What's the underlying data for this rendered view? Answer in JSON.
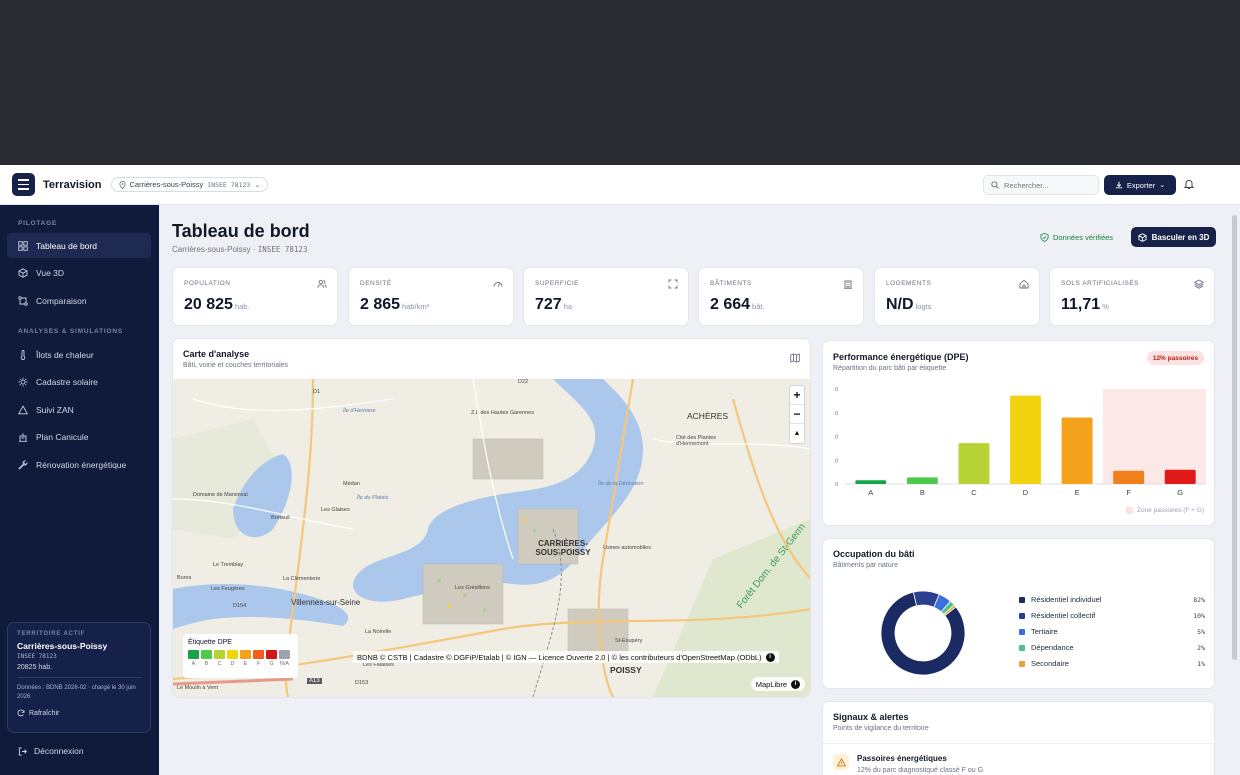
{
  "app": {
    "brand": "Terravision"
  },
  "topbar": {
    "location": "Carrières-sous-Poissy",
    "insee": "INSEE 78123",
    "search_placeholder": "Rechercher...",
    "export_label": "Exporter"
  },
  "sidebar": {
    "section1": "PILOTAGE",
    "section2": "ANALYSES & SIMULATIONS",
    "items": [
      {
        "label": "Tableau de bord",
        "icon": "grid-icon"
      },
      {
        "label": "Vue 3D",
        "icon": "cube-icon"
      },
      {
        "label": "Comparaison",
        "icon": "compare-icon"
      },
      {
        "label": "Îlots de chaleur",
        "icon": "thermometer-icon"
      },
      {
        "label": "Cadastre solaire",
        "icon": "sun-icon"
      },
      {
        "label": "Suivi ZAN",
        "icon": "triangle-icon"
      },
      {
        "label": "Plan Canicule",
        "icon": "building-icon"
      },
      {
        "label": "Rénovation énergétique",
        "icon": "wrench-icon"
      }
    ],
    "territory": {
      "label": "TERRITOIRE ACTIF",
      "name": "Carrières-sous-Poissy",
      "insee": "INSEE 78123",
      "population": "20825 hab.",
      "data_line": "Données : BDNB 2026-02 · chargé le 30 juin 2026",
      "refresh": "Rafraîchir"
    },
    "logout": "Déconnexion"
  },
  "header": {
    "title": "Tableau de bord",
    "subtitle_name": "Carrières-sous-Poissy · ",
    "subtitle_insee": "INSEE 78123",
    "verified": "Données vérifiées",
    "toggle_3d": "Basculer en 3D"
  },
  "kpis": [
    {
      "label": "POPULATION",
      "value": "20 825",
      "unit": "hab.",
      "icon": "users-icon"
    },
    {
      "label": "DENSITÉ",
      "value": "2 865",
      "unit": "hab/km²",
      "icon": "gauge-icon"
    },
    {
      "label": "SUPERFICIE",
      "value": "727",
      "unit": "ha",
      "icon": "expand-icon"
    },
    {
      "label": "BÂTIMENTS",
      "value": "2 664",
      "unit": "bât.",
      "icon": "building-icon"
    },
    {
      "label": "LOGEMENTS",
      "value": "N/D",
      "unit": "logts",
      "icon": "home-icon"
    },
    {
      "label": "SOLS ARTIFICIALISÉS",
      "value": "11,71",
      "unit": "%",
      "icon": "layers-icon"
    }
  ],
  "map": {
    "title": "Carte d'analyse",
    "subtitle": "Bâti, voirie et couches territoriales",
    "legend_title": "Étiquette DPE",
    "legend_labels": [
      "A",
      "B",
      "C",
      "D",
      "E",
      "F",
      "G",
      "N/A"
    ],
    "legend_colors": [
      "#16a34a",
      "#4ec94a",
      "#b7d334",
      "#f1d40f",
      "#f4a21b",
      "#f25d1c",
      "#d61515",
      "#9ca3af"
    ],
    "attribution": "BDNB © CSTB | Cadastre © DGFiP/Etalab | © IGN — Licence Ouverte 2.0 | © les contributeurs d'OpenStreetMap (ODbL)",
    "maplibre": "MapLibre",
    "places": [
      "ACHÈRES",
      "CARRIÈRES-SOUS-POISSY",
      "POISSY",
      "Villennes-sur-Seine",
      "Médan",
      "Breteuil",
      "Domaine de Marsinval",
      "Le Tremblay",
      "La Clémenterie",
      "Les Feugères",
      "Les Glaises",
      "Z.I. des Hautes Garennes",
      "Cité des Plantes d'Hennemont",
      "Usines automobiles",
      "Île d'Herniere",
      "Île du Platais",
      "Île de la Dérivation",
      "Les Grésillons",
      "La Noirelle",
      "Les Falaises",
      "Le Moulin à Vent",
      "St-Exupéry",
      "Forêt Dom. de St-Germ",
      "Bures",
      "D22",
      "D154",
      "D153",
      "D1",
      "A13"
    ],
    "controls": {
      "zoom_in": "+",
      "zoom_out": "−",
      "compass": "▲"
    }
  },
  "dpe": {
    "title": "Performance énergétique (DPE)",
    "subtitle": "Répartition du parc bâti par étiquette",
    "badge": "12% passoires",
    "zone_legend": "Zone passoires (F + G)"
  },
  "chart_data": {
    "type": "bar",
    "categories": [
      "A",
      "B",
      "C",
      "D",
      "E",
      "F",
      "G"
    ],
    "values": [
      4,
      7,
      43,
      93,
      70,
      14,
      15
    ],
    "colors": [
      "#16a34a",
      "#4ec94a",
      "#b7d334",
      "#f1d40f",
      "#f4a21b",
      "#f0801c",
      "#e01919"
    ],
    "ytick_labels": [
      "0",
      "0",
      "0",
      "0",
      "0"
    ],
    "ylim": [
      0,
      100
    ],
    "highlight_zone": [
      "F",
      "G"
    ],
    "zone_color": "#fde8e8"
  },
  "occupation": {
    "title": "Occupation du bâti",
    "subtitle": "Bâtiments par nature",
    "items": [
      {
        "label": "Résidentiel individuel",
        "pct": "82%",
        "value": 82,
        "color": "#1b2a63"
      },
      {
        "label": "Résidentiel collectif",
        "pct": "10%",
        "value": 10,
        "color": "#2a3f8f"
      },
      {
        "label": "Tertiaire",
        "pct": "5%",
        "value": 5,
        "color": "#3b6fe0"
      },
      {
        "label": "Dépendance",
        "pct": "2%",
        "value": 2,
        "color": "#4cc38a"
      },
      {
        "label": "Secondaire",
        "pct": "1%",
        "value": 1,
        "color": "#e9a23b"
      }
    ]
  },
  "alerts": {
    "title": "Signaux & alertes",
    "subtitle": "Points de vigilance du territoire",
    "items": [
      {
        "title": "Passoires énergétiques",
        "desc": "12% du parc diagnostiqué classé F ou G"
      }
    ]
  }
}
